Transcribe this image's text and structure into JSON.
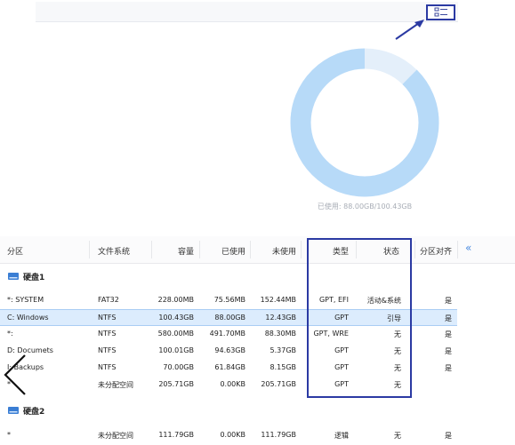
{
  "usage": {
    "text": "已使用: 88.00GB/100.43GB",
    "used_fraction": 0.8762,
    "used_color": "#b7daf8",
    "free_color": "#e4effa"
  },
  "icons": {
    "view_toggle": "grid-view-icon",
    "disk": "disk-icon",
    "collapse": "double-chevron-left-icon",
    "back": "chevron-left-icon"
  },
  "table": {
    "headers": {
      "partition": "分区",
      "filesystem": "文件系统",
      "capacity": "容量",
      "used": "已使用",
      "unused": "未使用",
      "type": "类型",
      "status": "状态",
      "alignment": "分区对齐",
      "collapse": "«"
    },
    "disks": [
      {
        "name": "硬盘1",
        "rows": [
          {
            "partition": "*: SYSTEM",
            "filesystem": "FAT32",
            "capacity": "228.00MB",
            "used": "75.56MB",
            "unused": "152.44MB",
            "type": "GPT, EFI",
            "status": "活动&系统",
            "alignment": "是",
            "selected": false
          },
          {
            "partition": "C: Windows",
            "filesystem": "NTFS",
            "capacity": "100.43GB",
            "used": "88.00GB",
            "unused": "12.43GB",
            "type": "GPT",
            "status": "引导",
            "alignment": "是",
            "selected": true
          },
          {
            "partition": "*:",
            "filesystem": "NTFS",
            "capacity": "580.00MB",
            "used": "491.70MB",
            "unused": "88.30MB",
            "type": "GPT, WRE",
            "status": "无",
            "alignment": "是",
            "selected": false
          },
          {
            "partition": "D: Documets",
            "filesystem": "NTFS",
            "capacity": "100.01GB",
            "used": "94.63GB",
            "unused": "5.37GB",
            "type": "GPT",
            "status": "无",
            "alignment": "是",
            "selected": false
          },
          {
            "partition": "I: Backups",
            "filesystem": "NTFS",
            "capacity": "70.00GB",
            "used": "61.84GB",
            "unused": "8.15GB",
            "type": "GPT",
            "status": "无",
            "alignment": "是",
            "selected": false
          },
          {
            "partition": "*",
            "filesystem": "未分配空间",
            "capacity": "205.71GB",
            "used": "0.00KB",
            "unused": "205.71GB",
            "type": "GPT",
            "status": "无",
            "alignment": "",
            "selected": false
          }
        ]
      },
      {
        "name": "硬盘2",
        "rows": [
          {
            "partition": "*",
            "filesystem": "未分配空间",
            "capacity": "111.79GB",
            "used": "0.00KB",
            "unused": "111.79GB",
            "type": "逻辑",
            "status": "无",
            "alignment": "是",
            "selected": false
          }
        ]
      }
    ]
  }
}
